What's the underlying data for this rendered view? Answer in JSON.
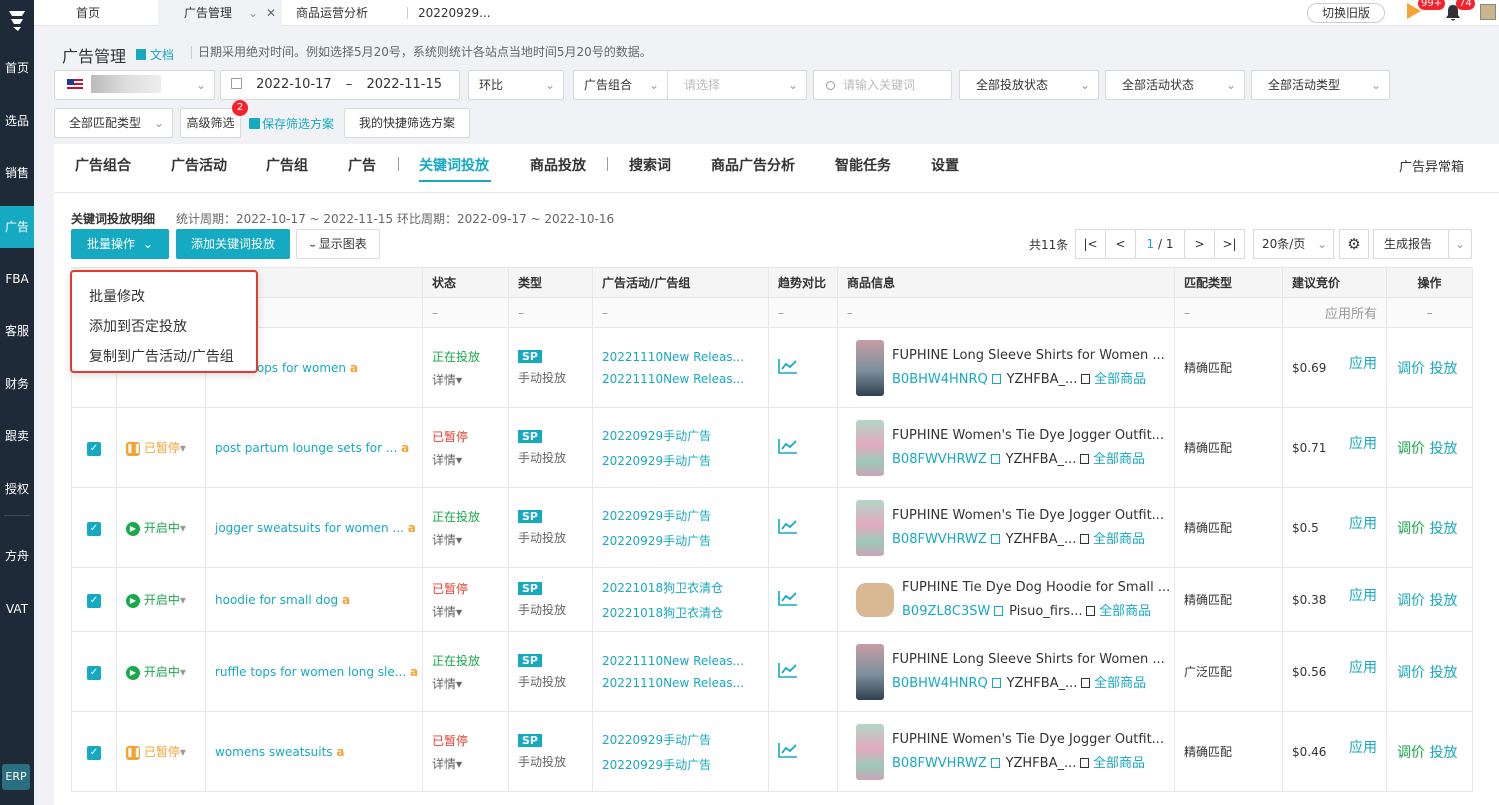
{
  "sidebar": {
    "items": [
      "首页",
      "选品",
      "销售",
      "广告",
      "FBA",
      "客服",
      "财务",
      "跟卖",
      "授权",
      "方舟",
      "VAT"
    ],
    "erp": "ERP",
    "active": "广告"
  },
  "topbar": {
    "tabs": [
      "首页",
      "广告管理",
      "商品运营分析",
      "20220929..."
    ],
    "switch_label": "切换旧版",
    "flag_badge": "99+",
    "bell_badge": "74"
  },
  "header": {
    "title": "广告管理",
    "doc_link": "文档",
    "hint": "日期采用绝对时间。例如选择5月20号，系统则统计各站点当地时间5月20号的数据。"
  },
  "filters": {
    "date_start": "2022-10-17",
    "date_sep": "–",
    "date_end": "2022-11-15",
    "compare": "环比",
    "group_type": "广告组合",
    "group_placeholder": "请选择",
    "keyword_placeholder": "请输入关键词",
    "delivery_status": "全部投放状态",
    "activity_status": "全部活动状态",
    "activity_type": "全部活动类型",
    "match_type": "全部匹配类型",
    "advanced": "高级筛选",
    "advanced_badge": "2",
    "save_scheme": "保存筛选方案",
    "my_schemes": "我的快捷筛选方案"
  },
  "nav_tabs": [
    "广告组合",
    "广告活动",
    "广告组",
    "广告",
    "关键词投放",
    "商品投放",
    "搜索词",
    "商品广告分析",
    "智能任务",
    "设置"
  ],
  "nav_active": "关键词投放",
  "anomaly_box": "广告异常箱",
  "section": {
    "title": "关键词投放明细",
    "period": "统计周期：2022-10-17 ~ 2022-11-15  环比周期：2022-09-17 ~ 2022-10-16"
  },
  "toolbar": {
    "batch": "批量操作",
    "add": "添加关键词投放",
    "chart": "显示图表",
    "total": "共11条",
    "page": "1",
    "pages": "/ 1",
    "per_page": "20条/页",
    "report": "生成报告"
  },
  "dropdown": {
    "items": [
      "批量修改",
      "添加到否定投放",
      "复制到广告活动/广告组"
    ]
  },
  "table": {
    "columns": [
      "状态",
      "类型",
      "广告活动/广告组",
      "趋势对比",
      "商品信息",
      "匹配类型",
      "建议竞价",
      "操作"
    ],
    "filter_dash": "–",
    "apply_all": "应用所有",
    "rows": [
      {
        "toggle": "",
        "keyword": "...eve tops for women",
        "state": "正在投放",
        "state_cls": "on",
        "detail": "详情",
        "type": "SP",
        "type_sub": "手动投放",
        "campaign": "20221110New Releas...",
        "group": "20221110New Releas...",
        "title": "FUPHINE Long Sleeve Shirts for Women ...",
        "asin": "B0BHW4HNRQ",
        "sku": "YZHFBA_...",
        "all": "全部商品",
        "match": "精确匹配",
        "bid": "$0.69",
        "apply": "应用",
        "op1": "调价",
        "op2": "投放",
        "thumb": "pink"
      },
      {
        "toggle": "已暂停",
        "keyword": "post partum lounge sets for ...",
        "state": "已暂停",
        "state_cls": "off",
        "detail": "详情",
        "type": "SP",
        "type_sub": "手动投放",
        "campaign": "20220929手动广告",
        "group": "20220929手动广告",
        "title": "FUPHINE Women's Tie Dye Jogger Outfit...",
        "asin": "B08FWVHRWZ",
        "sku": "YZHFBA_...",
        "all": "全部商品",
        "match": "精确匹配",
        "bid": "$0.71",
        "apply": "应用",
        "op1": "调价",
        "op2": "投放",
        "thumb": "tiedye"
      },
      {
        "toggle": "开启中",
        "keyword": "jogger sweatsuits for women ...",
        "state": "正在投放",
        "state_cls": "on",
        "detail": "详情",
        "type": "SP",
        "type_sub": "手动投放",
        "campaign": "20220929手动广告",
        "group": "20220929手动广告",
        "title": "FUPHINE Women's Tie Dye Jogger Outfit...",
        "asin": "B08FWVHRWZ",
        "sku": "YZHFBA_...",
        "all": "全部商品",
        "match": "精确匹配",
        "bid": "$0.5",
        "apply": "应用",
        "op1": "调价",
        "op2": "投放",
        "thumb": "tiedye"
      },
      {
        "toggle": "开启中",
        "keyword": "hoodie for small dog",
        "state": "已暂停",
        "state_cls": "off",
        "detail": "详情",
        "type": "SP",
        "type_sub": "手动投放",
        "campaign": "20221018狗卫衣清仓",
        "group": "20221018狗卫衣清仓",
        "title": "FUPHINE Tie Dye Dog Hoodie for Small ...",
        "asin": "B09ZL8C3SW",
        "sku": "Pisuo_firs...",
        "all": "全部商品",
        "match": "精确匹配",
        "bid": "$0.38",
        "apply": "应用",
        "op1": "调价",
        "op2": "投放",
        "thumb": "dog"
      },
      {
        "toggle": "开启中",
        "keyword": "ruffle tops for women long sle...",
        "state": "正在投放",
        "state_cls": "on",
        "detail": "详情",
        "type": "SP",
        "type_sub": "手动投放",
        "campaign": "20221110New Releas...",
        "group": "20221110New Releas...",
        "title": "FUPHINE Long Sleeve Shirts for Women ...",
        "asin": "B0BHW4HNRQ",
        "sku": "YZHFBA_...",
        "all": "全部商品",
        "match": "广泛匹配",
        "bid": "$0.56",
        "apply": "应用",
        "op1": "调价",
        "op2": "投放",
        "thumb": "pink"
      },
      {
        "toggle": "已暂停",
        "keyword": "womens sweatsuits",
        "state": "已暂停",
        "state_cls": "off",
        "detail": "详情",
        "type": "SP",
        "type_sub": "手动投放",
        "campaign": "20220929手动广告",
        "group": "20220929手动广告",
        "title": "FUPHINE Women's Tie Dye Jogger Outfit...",
        "asin": "B08FWVHRWZ",
        "sku": "YZHFBA_...",
        "all": "全部商品",
        "match": "精确匹配",
        "bid": "$0.46",
        "apply": "应用",
        "op1": "调价",
        "op2": "投放",
        "thumb": "tiedye"
      }
    ]
  },
  "colors": {
    "accent": "#16a9c2",
    "sidebar": "#1e2a38",
    "on": "#19a84a",
    "off": "#e83c2e",
    "pause": "#f7a234"
  }
}
